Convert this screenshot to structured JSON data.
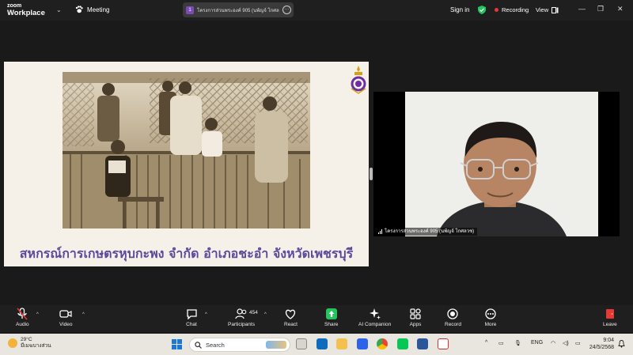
{
  "topbar": {
    "brand_top": "zoom",
    "brand_bottom": "Workplace",
    "meeting_label": "Meeting",
    "meeting_title_num": "1",
    "meeting_title": "โครงการส่วนพระองค์ 905 (นพ้ญจ์ โกศล",
    "meeting_title_more": "···",
    "signin_label": "Sign in",
    "recording_label": "Recording",
    "view_label": "View"
  },
  "slide": {
    "caption": "สหกรณ์การเกษตรหุบกะพง จำกัด อำเภอชะอำ จังหวัดเพชรบุรี",
    "caption_color": "#5b4a9c"
  },
  "video": {
    "participant_name": "โครงการส่วนพระองค์ 905 (นพ้ญจ์ โกศลวช)"
  },
  "toolbar": {
    "audio_label": "Audio",
    "video_label": "Video",
    "chat_label": "Chat",
    "participants_label": "Participants",
    "participants_count": "454",
    "react_label": "React",
    "share_label": "Share",
    "ai_label": "AI Companion",
    "apps_label": "Apps",
    "record_label": "Record",
    "more_label": "More",
    "leave_label": "Leave",
    "share_color": "#22c55e",
    "leave_color": "#e53935"
  },
  "taskbar": {
    "temp": "29°C",
    "weather_desc": "มีเมฆบางส่วน",
    "search_placeholder": "Search",
    "lang": "ENG",
    "time": "9:04",
    "date": "24/5/2568"
  }
}
